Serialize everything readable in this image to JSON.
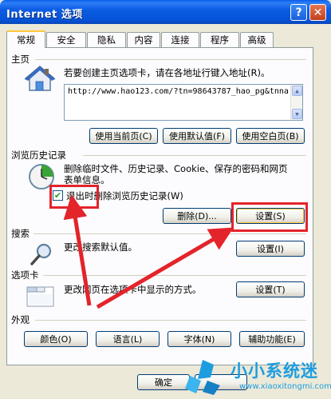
{
  "window": {
    "title": "Internet 选项",
    "help_label": "?",
    "close_label": "✕"
  },
  "tabs": [
    {
      "label": "常规",
      "active": true
    },
    {
      "label": "安全"
    },
    {
      "label": "隐私"
    },
    {
      "label": "内容"
    },
    {
      "label": "连接"
    },
    {
      "label": "程序"
    },
    {
      "label": "高级"
    }
  ],
  "homepage": {
    "title": "主页",
    "description": "若要创建主页选项卡，请在各地址行键入地址(R)。",
    "url": "http://www.hao123.com/?tn=98643787_hao_pg&tnna",
    "use_current": "使用当前页(C)",
    "use_default": "使用默认值(F)",
    "use_blank": "使用空白页(B)",
    "icon": "house-icon"
  },
  "history": {
    "title": "浏览历史记录",
    "description_line1": "删除临时文件、历史记录、Cookie、保存的密码和网页",
    "description_line2": "表单信息。",
    "checkbox_label": "退出时删除浏览历史记录(W)",
    "checkbox_mark": "✔",
    "checked": true,
    "delete_button": "删除(D)...",
    "settings_button": "设置(S)",
    "icon": "history-clock-icon"
  },
  "search": {
    "title": "搜索",
    "description": "更改搜索默认值。",
    "settings_button": "设置(I)",
    "icon": "magnifier-icon"
  },
  "tabs_section": {
    "title": "选项卡",
    "description": "更改网页在选项卡中显示的方式。",
    "settings_button": "设置(T)",
    "icon": "tabs-window-icon"
  },
  "appearance": {
    "title": "外观",
    "colors": "颜色(O)",
    "languages": "语言(L)",
    "fonts": "字体(N)",
    "accessibility": "辅助功能(E)"
  },
  "footer": {
    "ok": "确定"
  },
  "watermark": {
    "text": "小小系统迷",
    "url": "www.xiaoxitongmi.com"
  },
  "colors": {
    "title_bar": "#0c5de4",
    "annotation": "#e3242b",
    "watermark": "#1d9de0"
  }
}
